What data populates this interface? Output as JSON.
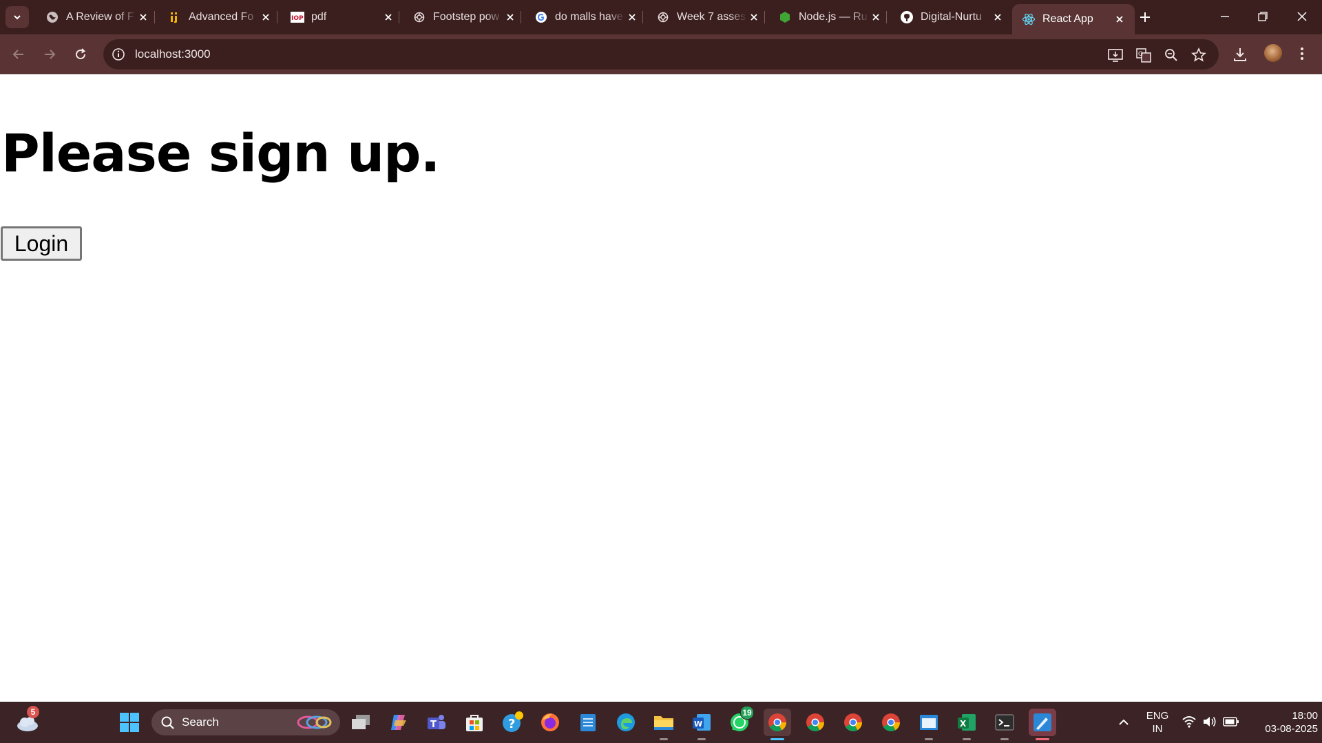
{
  "browser": {
    "tabs": [
      {
        "title": "A Review of F",
        "icon": "globe-icon",
        "active": false
      },
      {
        "title": "Advanced Fo",
        "icon": "ij-icon",
        "active": false
      },
      {
        "title": "pdf",
        "icon": "iop-pdf-icon",
        "active": false
      },
      {
        "title": "Footstep pow",
        "icon": "chatgpt-icon",
        "active": false
      },
      {
        "title": "do malls have",
        "icon": "google-icon",
        "active": false
      },
      {
        "title": "Week 7 asses",
        "icon": "chatgpt-icon",
        "active": false
      },
      {
        "title": "Node.js — Ru",
        "icon": "nodejs-icon",
        "active": false
      },
      {
        "title": "Digital-Nurtu",
        "icon": "github-icon",
        "active": false
      },
      {
        "title": "React App",
        "icon": "react-icon",
        "active": true
      }
    ],
    "address": "localhost:3000"
  },
  "page": {
    "heading": "Please sign up.",
    "login_label": "Login"
  },
  "taskbar": {
    "search_label": "Search",
    "weather_badge": "5",
    "whatsapp_badge": "19",
    "language_line1": "ENG",
    "language_line2": "IN",
    "time": "18:00",
    "date": "03-08-2025"
  },
  "colors": {
    "tab_strip": "#3b1f1f",
    "toolbar": "#5a3434",
    "taskbar": "#3b2326"
  }
}
